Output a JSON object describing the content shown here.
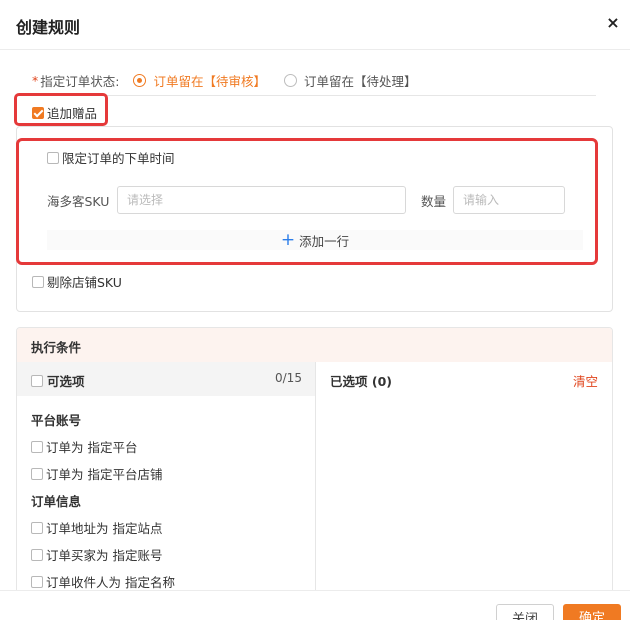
{
  "dialog": {
    "title": "创建规则",
    "close_icon": "×"
  },
  "status": {
    "required_mark": "*",
    "label": "指定订单状态:",
    "options": [
      {
        "label": "订单留在【待审核】",
        "selected": true
      },
      {
        "label": "订单留在【待处理】",
        "selected": false
      }
    ]
  },
  "gift": {
    "label": "追加赠品",
    "checked": true,
    "limit_time_label": "限定订单的下单时间",
    "sku_label": "海多客SKU",
    "sku_placeholder": "请选择",
    "qty_label": "数量",
    "qty_placeholder": "请输入",
    "add_row_icon": "+",
    "add_row_label": "添加一行",
    "exclude_label": "剔除店铺SKU"
  },
  "conditions": {
    "title": "执行条件",
    "available_label": "可选项",
    "available_count": "0/15",
    "selected_label": "已选项 (0)",
    "clear_label": "清空",
    "groups": [
      {
        "title": "平台账号",
        "items": [
          "订单为 指定平台",
          "订单为 指定平台店铺"
        ]
      },
      {
        "title": "订单信息",
        "items": [
          "订单地址为 指定站点",
          "订单买家为 指定账号",
          "订单收件人为 指定名称"
        ]
      }
    ]
  },
  "footer": {
    "close_label": "关闭",
    "ok_label": "确定"
  },
  "colors": {
    "accent": "#f07a22",
    "danger": "#e0451d",
    "highlight_border": "#e5393a",
    "link_blue": "#2b7de9"
  }
}
